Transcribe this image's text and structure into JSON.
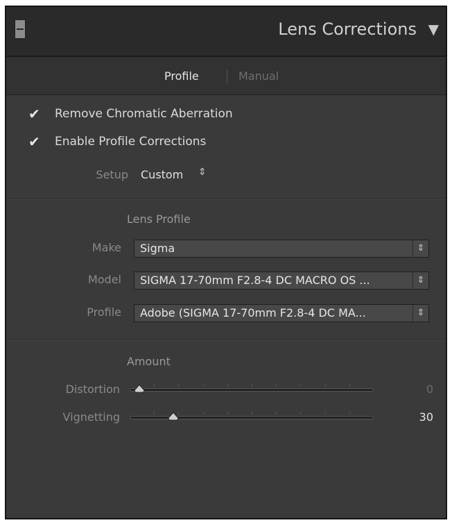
{
  "header": {
    "title": "Lens Corrections",
    "collapse_glyph": "▼"
  },
  "tabs": {
    "profile": "Profile",
    "manual": "Manual"
  },
  "checkboxes": [
    {
      "label": "Remove Chromatic Aberration",
      "checked": true
    },
    {
      "label": "Enable Profile Corrections",
      "checked": true
    }
  ],
  "check_glyph": "✔",
  "setup": {
    "label": "Setup",
    "value": "Custom",
    "arrow": "⇕"
  },
  "lens_profile": {
    "title": "Lens Profile",
    "make": {
      "label": "Make",
      "value": "Sigma"
    },
    "model": {
      "label": "Model",
      "value": "SIGMA 17-70mm F2.8-4 DC MACRO OS ..."
    },
    "profile": {
      "label": "Profile",
      "value": "Adobe (SIGMA 17-70mm F2.8-4 DC MA..."
    },
    "select_arrow": "⇕"
  },
  "amount": {
    "title": "Amount",
    "sliders": [
      {
        "label": "Distortion",
        "value": "0",
        "fraction": 0.04,
        "value_color": "#6c6c6c"
      },
      {
        "label": "Vignetting",
        "value": "30",
        "fraction": 0.18,
        "value_color": "#e6e6e6"
      }
    ]
  },
  "colors": {
    "panel_bg": "#3a3a3a",
    "header_bg": "#2a2a2a",
    "text_dim": "#8a8a8a"
  }
}
